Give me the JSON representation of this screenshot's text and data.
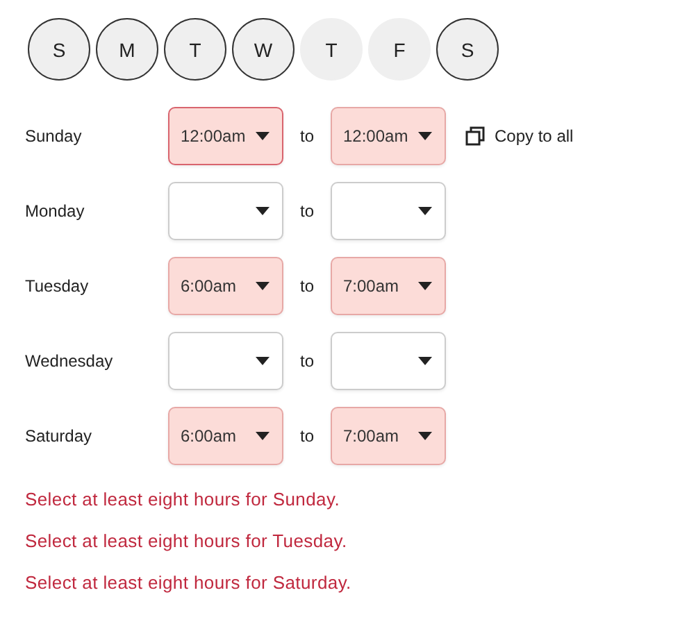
{
  "days": [
    {
      "label": "S",
      "selected": true
    },
    {
      "label": "M",
      "selected": true
    },
    {
      "label": "T",
      "selected": true
    },
    {
      "label": "W",
      "selected": true
    },
    {
      "label": "T",
      "selected": false
    },
    {
      "label": "F",
      "selected": false
    },
    {
      "label": "S",
      "selected": true
    }
  ],
  "schedule": [
    {
      "day": "Sunday",
      "from": {
        "value": "12:00am",
        "error": true,
        "focused": true
      },
      "separator": "to",
      "to": {
        "value": "12:00am",
        "error": true,
        "focused": false
      },
      "copy_action": "Copy to all"
    },
    {
      "day": "Monday",
      "from": {
        "error": false,
        "focused": false
      },
      "separator": "to",
      "to": {
        "error": false,
        "focused": false
      }
    },
    {
      "day": "Tuesday",
      "from": {
        "value": "6:00am",
        "error": true,
        "focused": false
      },
      "separator": "to",
      "to": {
        "value": "7:00am",
        "error": true,
        "focused": false
      }
    },
    {
      "day": "Wednesday",
      "from": {
        "error": false,
        "focused": false
      },
      "separator": "to",
      "to": {
        "error": false,
        "focused": false
      }
    },
    {
      "day": "Saturday",
      "from": {
        "value": "6:00am",
        "error": true,
        "focused": false
      },
      "separator": "to",
      "to": {
        "value": "7:00am",
        "error": true,
        "focused": false
      }
    }
  ],
  "errors": [
    "Select at least eight hours for Sunday.",
    "Select at least eight hours for Tuesday.",
    "Select at least eight hours for Saturday."
  ]
}
